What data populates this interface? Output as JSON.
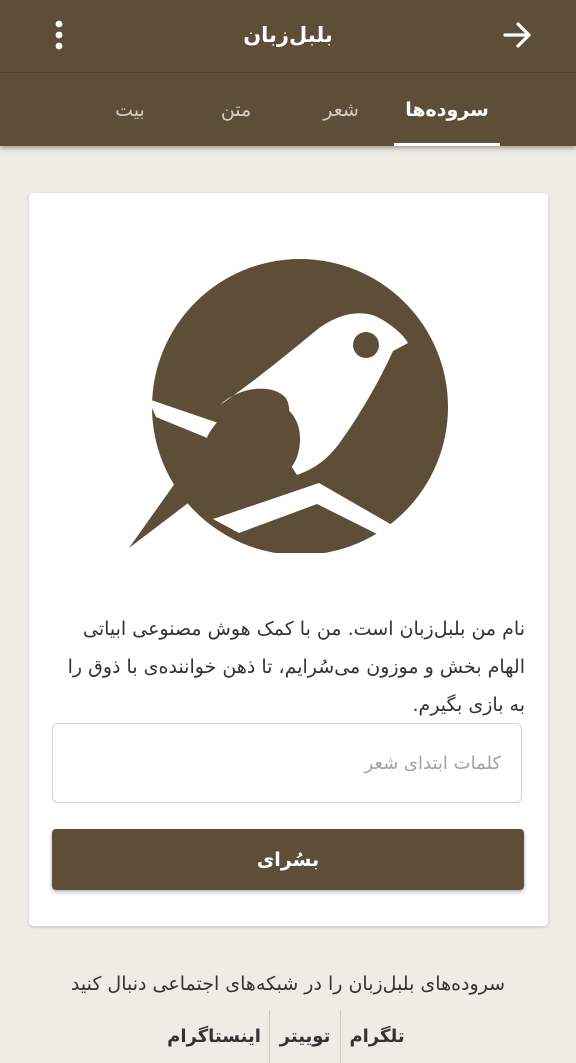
{
  "app": {
    "title": "بلبل‌زبان"
  },
  "tabs": [
    {
      "label": "سروده‌ها",
      "active": true
    },
    {
      "label": "شعر",
      "active": false
    },
    {
      "label": "متن",
      "active": false
    },
    {
      "label": "بیت",
      "active": false
    }
  ],
  "card": {
    "intro": "نام من بلبل‌زبان است. من با کمک هوش مصنوعی ابیاتی الهام بخش و موزون می‌سُرایم، تا ذهن خواننده‌ی با ذوق را به بازی بگیرم.",
    "input_placeholder": "کلمات ابتدای شعر",
    "input_value": "",
    "compose_button": "بسُرای"
  },
  "social": {
    "heading": "سروده‌های بلبل‌زبان را در شبکه‌های اجتماعی دنبال کنید",
    "links": [
      "تلگرام",
      "توییتر",
      "اینستاگرام"
    ]
  },
  "icons": {
    "menu": "more-vertical-icon",
    "back": "arrow-right-icon",
    "logo": "bird-logo"
  },
  "colors": {
    "primary": "#5f4e37",
    "background": "#efece6",
    "card": "#ffffff"
  }
}
